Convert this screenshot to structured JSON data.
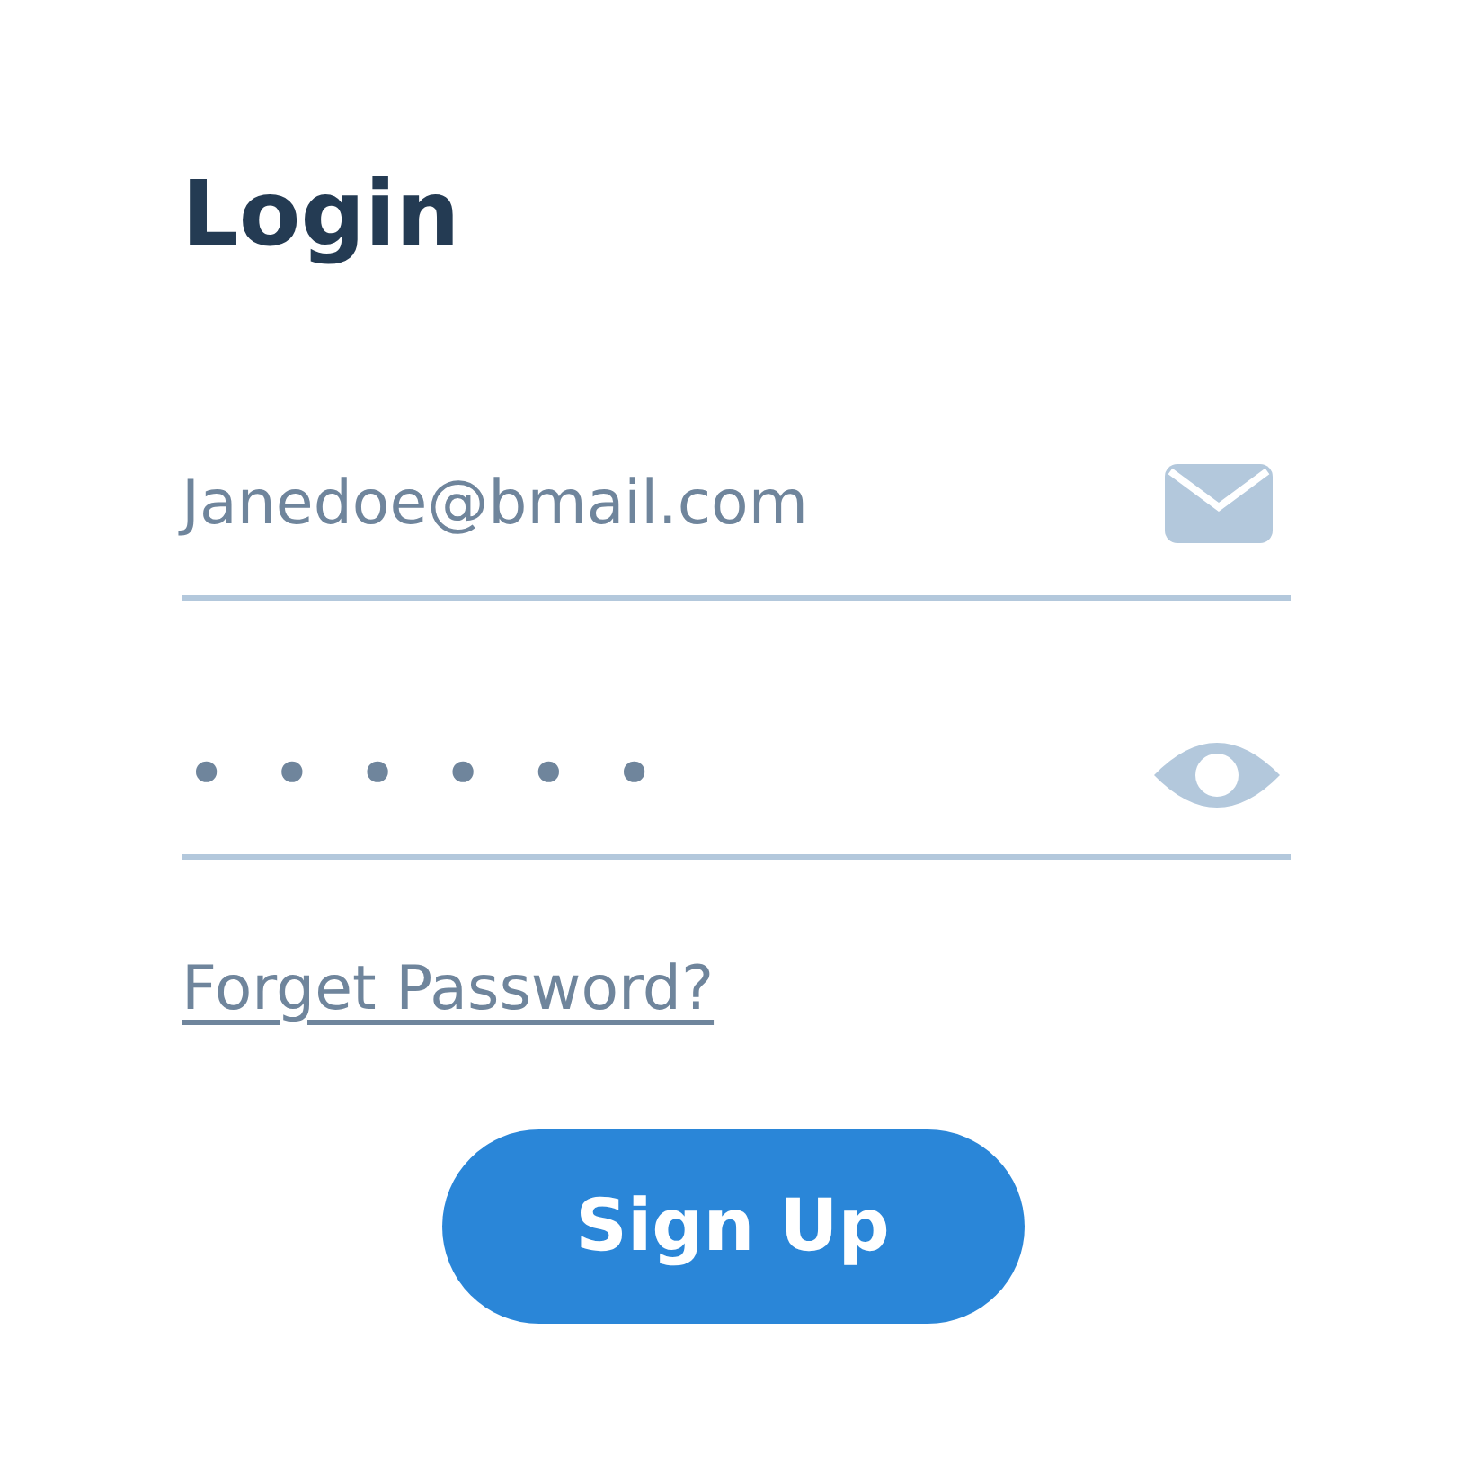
{
  "title": "Login",
  "email": {
    "value": "Janedoe@bmail.com"
  },
  "password": {
    "value": "••••••"
  },
  "forgot_link": "Forget Password?",
  "submit_button": "Sign Up"
}
